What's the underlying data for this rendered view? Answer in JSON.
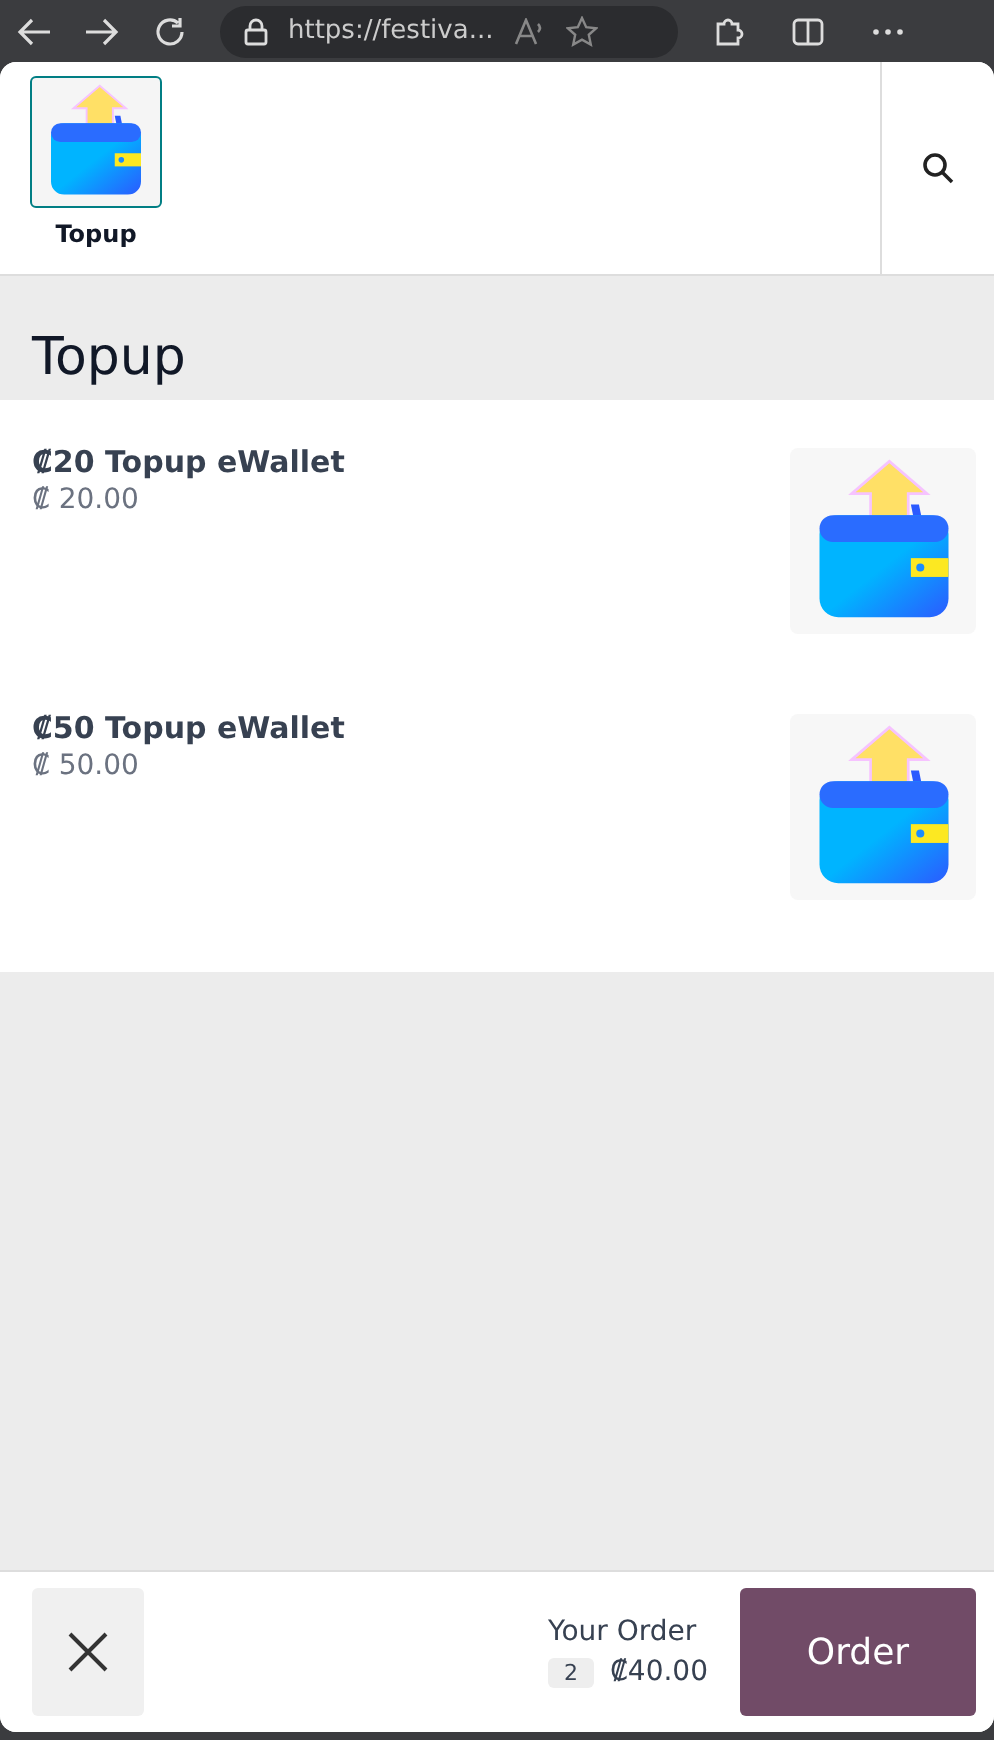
{
  "browser": {
    "url": "https://festiva..."
  },
  "categories": [
    {
      "label": "Topup",
      "selected": true
    }
  ],
  "section": {
    "title": "Topup"
  },
  "products": [
    {
      "name": "₡20 Topup eWallet",
      "price": "₡ 20.00"
    },
    {
      "name": "₡50 Topup eWallet",
      "price": "₡ 50.00"
    }
  ],
  "footer": {
    "label": "Your Order",
    "count": "2",
    "total": "₡40.00",
    "button": "Order"
  }
}
